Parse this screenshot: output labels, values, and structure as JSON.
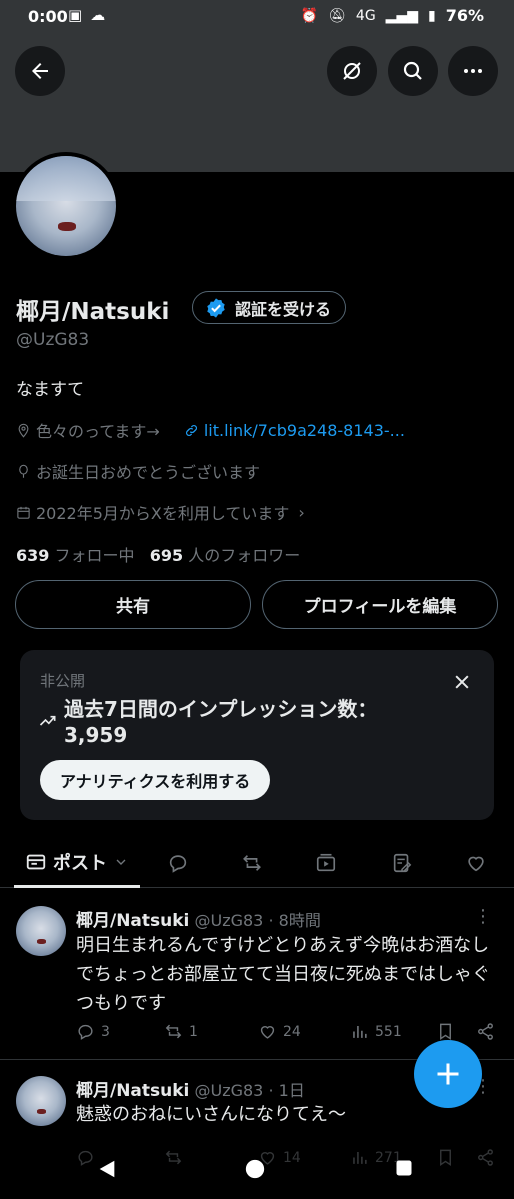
{
  "status_bar": {
    "time": "0:00",
    "network": "4G",
    "battery": "76%"
  },
  "profile": {
    "name": "椰月/Natsuki",
    "verify_label": "認証を受ける",
    "handle": "@UzG83",
    "bio": "なますて",
    "location": "色々のってます→",
    "link": "lit.link/7cb9a248-8143-...",
    "birthday": "お誕生日おめでとうございます",
    "joined": "2022年5月からXを利用しています",
    "following_count": "639",
    "following_label": "フォロー中",
    "followers_count": "695",
    "followers_label": "人のフォロワー"
  },
  "buttons": {
    "share": "共有",
    "edit_profile": "プロフィールを編集"
  },
  "impressions_card": {
    "private_label": "非公開",
    "title": "過去7日間のインプレッション数：",
    "value": "3,959",
    "analytics_button": "アナリティクスを利用する"
  },
  "tabs": {
    "posts_label": "ポスト"
  },
  "posts": [
    {
      "name": "椰月/Natsuki",
      "handle": "@UzG83",
      "time": "8時間",
      "text": "明日生まれるんですけどとりあえず今晩はお酒なしでちょっとお部屋立てて当日夜に死ぬまではしゃぐつもりです",
      "replies": "3",
      "reposts": "1",
      "likes": "24",
      "views": "551"
    },
    {
      "name": "椰月/Natsuki",
      "handle": "@UzG83",
      "time": "1日",
      "text": "魅惑のおねにいさんになりてえ〜",
      "replies": "",
      "reposts": "",
      "likes": "14",
      "views": "271"
    }
  ],
  "colors": {
    "accent": "#1d9bf0",
    "background": "#000000",
    "text_primary": "#e7e9ea",
    "text_secondary": "#71767b"
  }
}
